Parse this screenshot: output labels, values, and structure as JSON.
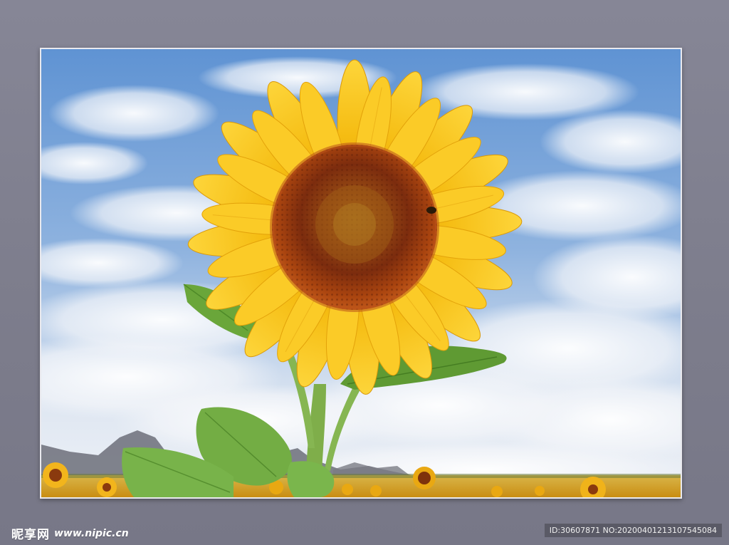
{
  "watermark": {
    "logo_text": "昵享网",
    "url": "www.nipic.cn",
    "id_text": "ID:30607871 NO:20200401213107545084"
  },
  "photo": {
    "subject": "sunflower",
    "colors": {
      "petal": "#f7c21a",
      "petal_dark": "#e7a40c",
      "center": "#7a2a0c",
      "center_ring": "#a7410f",
      "sky_blue": "#5a8fd2",
      "cloud": "#f2f4f8",
      "leaf": "#6aa63a",
      "stem": "#7fb04b",
      "mountain": "#6b6e78",
      "field": "#e0a41a",
      "background_gray": "#7e7e8e"
    }
  }
}
